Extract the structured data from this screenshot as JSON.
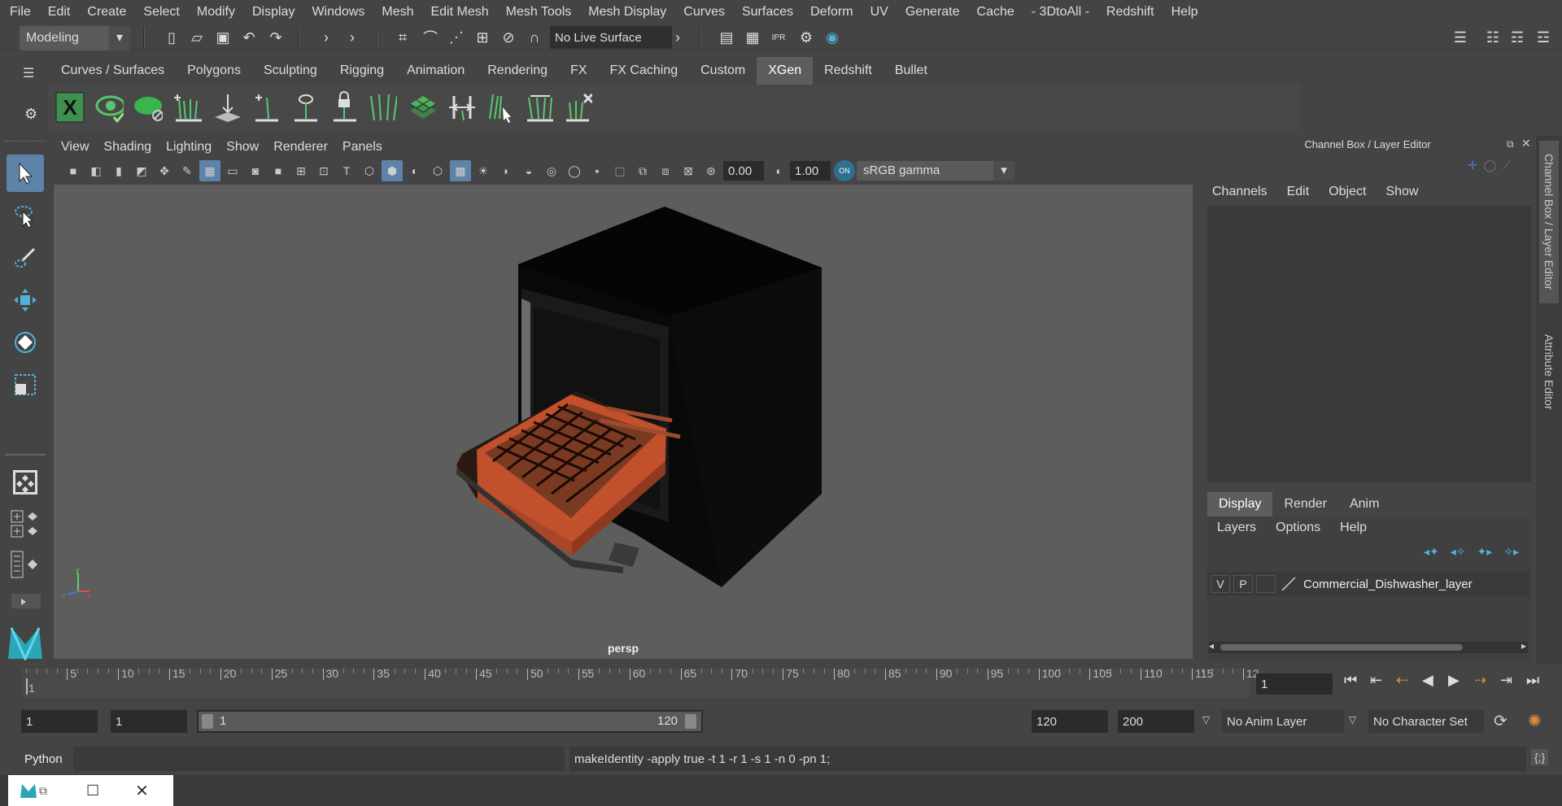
{
  "menubar": {
    "items": [
      "File",
      "Edit",
      "Create",
      "Select",
      "Modify",
      "Display",
      "Windows",
      "Mesh",
      "Edit Mesh",
      "Mesh Tools",
      "Mesh Display",
      "Curves",
      "Surfaces",
      "Deform",
      "UV",
      "Generate",
      "Cache",
      "- 3DtoAll -",
      "Redshift",
      "Help"
    ]
  },
  "statusline": {
    "mode": "Modeling",
    "live_surface": "No Live Surface"
  },
  "shelf": {
    "tabs": [
      "Curves / Surfaces",
      "Polygons",
      "Sculpting",
      "Rigging",
      "Animation",
      "Rendering",
      "FX",
      "FX Caching",
      "Custom",
      "XGen",
      "Redshift",
      "Bullet"
    ],
    "active_tab": "XGen",
    "icons": [
      "xgen-editor-icon",
      "xgen-preview-icon",
      "xgen-create-description-icon",
      "xgen-add-guides-icon",
      "xgen-place-guides-icon",
      "xgen-add-guide-icon",
      "xgen-select-guides-icon",
      "xgen-lock-guides-icon",
      "xgen-sculpt-guides-icon",
      "xgen-density-icon",
      "xgen-cut-guides-icon",
      "xgen-comb-guides-icon",
      "xgen-guide-length-icon",
      "xgen-delete-guides-icon"
    ]
  },
  "viewport": {
    "menus": [
      "View",
      "Shading",
      "Lighting",
      "Show",
      "Renderer",
      "Panels"
    ],
    "exposure": "0.00",
    "gamma": "1.00",
    "color_space": "sRGB gamma",
    "camera_label": "persp",
    "colors": {
      "background": "#5d5d5d",
      "cabinet": "#080808",
      "rack": "#c2502c"
    }
  },
  "channel_box": {
    "title": "Channel Box / Layer Editor",
    "menus": [
      "Channels",
      "Edit",
      "Object",
      "Show"
    ]
  },
  "layer_editor": {
    "tabs": [
      "Display",
      "Render",
      "Anim"
    ],
    "active_tab": "Display",
    "menus": [
      "Layers",
      "Options",
      "Help"
    ],
    "layer": {
      "v": "V",
      "p": "P",
      "name": "Commercial_Dishwasher_layer"
    }
  },
  "side_tabs": [
    "Channel Box / Layer Editor",
    "Attribute Editor"
  ],
  "timeline": {
    "ticks": [
      "5",
      "10",
      "15",
      "20",
      "25",
      "30",
      "35",
      "40",
      "45",
      "50",
      "55",
      "60",
      "65",
      "70",
      "75",
      "80",
      "85",
      "90",
      "95",
      "100",
      "105",
      "110",
      "115",
      "12"
    ],
    "first_frame": "1",
    "current_frame": "1"
  },
  "range": {
    "start": "1",
    "playback_start": "1",
    "slider_start": "1",
    "slider_end": "120",
    "playback_end": "120",
    "end": "200",
    "anim_layer": "No Anim Layer",
    "character_set": "No Character Set"
  },
  "command_line": {
    "language": "Python",
    "output": "makeIdentity -apply true -t 1 -r 1 -s 1 -n 0 -pn 1;"
  }
}
